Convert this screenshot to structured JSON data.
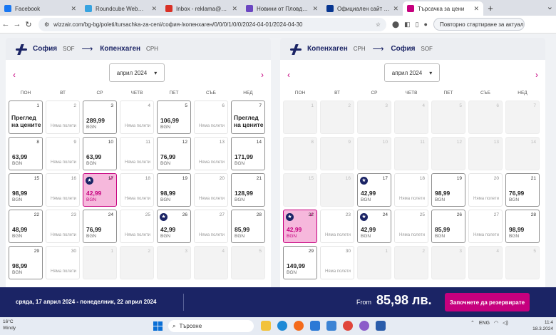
{
  "browser": {
    "tabs": [
      {
        "title": "Facebook",
        "color": "#1877f2",
        "active": false
      },
      {
        "title": "Roundcube Webmail :: Inb",
        "color": "#37a3e0",
        "active": false
      },
      {
        "title": "Inbox - reklama@poctepe",
        "color": "#d93025",
        "active": false
      },
      {
        "title": "Новини от Пловдив - Акт",
        "color": "#6b46c1",
        "active": false
      },
      {
        "title": "Официален сайт Ryanair",
        "color": "#073590",
        "active": false
      },
      {
        "title": "Търсачка за цени",
        "color": "#c6007e",
        "active": true
      }
    ],
    "new_tab": "+",
    "url": "wizzair.com/bg-bg/poleti/tursachka-za-ceni/софия-/копенхаген/0/0/0/1/0/0/2024-04-01/2024-04-30",
    "restart_label": "Повторно стартиране за актуализиране"
  },
  "left_panel": {
    "from_city": "София",
    "from_code": "SOF",
    "to_city": "Копенхаген",
    "to_code": "CPH",
    "month": "април 2024",
    "weekdays": [
      "ПОН",
      "ВТ",
      "СР",
      "ЧЕТВ",
      "ПЕТ",
      "СЪБ",
      "НЕД"
    ],
    "days": [
      {
        "d": "1",
        "type": "link",
        "text": "Преглед на цените"
      },
      {
        "d": "2",
        "type": "none",
        "text": "Няма полети"
      },
      {
        "d": "3",
        "type": "price",
        "price": "289,99",
        "cur": "BGN"
      },
      {
        "d": "4",
        "type": "none",
        "text": "Няма полети"
      },
      {
        "d": "5",
        "type": "price",
        "price": "106,99",
        "cur": "BGN"
      },
      {
        "d": "6",
        "type": "none",
        "text": "Няма полети"
      },
      {
        "d": "7",
        "type": "link",
        "text": "Преглед на цените"
      },
      {
        "d": "8",
        "type": "price",
        "price": "63,99",
        "cur": "BGN"
      },
      {
        "d": "9",
        "type": "none",
        "text": "Няма полети"
      },
      {
        "d": "10",
        "type": "price",
        "price": "63,99",
        "cur": "BGN"
      },
      {
        "d": "11",
        "type": "none",
        "text": "Няма полети"
      },
      {
        "d": "12",
        "type": "price",
        "price": "76,99",
        "cur": "BGN"
      },
      {
        "d": "13",
        "type": "none",
        "text": "Няма полети"
      },
      {
        "d": "14",
        "type": "price",
        "price": "171,99",
        "cur": "BGN"
      },
      {
        "d": "15",
        "type": "price",
        "price": "98,99",
        "cur": "BGN"
      },
      {
        "d": "16",
        "type": "none",
        "text": "Няма полети"
      },
      {
        "d": "17",
        "type": "price",
        "price": "42,99",
        "cur": "BGN",
        "star": true,
        "selected": true
      },
      {
        "d": "18",
        "type": "none",
        "text": "Няма полети"
      },
      {
        "d": "19",
        "type": "price",
        "price": "98,99",
        "cur": "BGN"
      },
      {
        "d": "20",
        "type": "none",
        "text": "Няма полети"
      },
      {
        "d": "21",
        "type": "price",
        "price": "128,99",
        "cur": "BGN"
      },
      {
        "d": "22",
        "type": "price",
        "price": "48,99",
        "cur": "BGN"
      },
      {
        "d": "23",
        "type": "none",
        "text": "Няма полети"
      },
      {
        "d": "24",
        "type": "price",
        "price": "76,99",
        "cur": "BGN"
      },
      {
        "d": "25",
        "type": "none",
        "text": "Няма полети"
      },
      {
        "d": "26",
        "type": "price",
        "price": "42,99",
        "cur": "BGN",
        "star": true
      },
      {
        "d": "27",
        "type": "none",
        "text": "Няма полети"
      },
      {
        "d": "28",
        "type": "price",
        "price": "85,99",
        "cur": "BGN"
      },
      {
        "d": "29",
        "type": "price",
        "price": "98,99",
        "cur": "BGN"
      },
      {
        "d": "30",
        "type": "none",
        "text": "Няма полети"
      },
      {
        "d": "1",
        "type": "na"
      },
      {
        "d": "2",
        "type": "na"
      },
      {
        "d": "3",
        "type": "na"
      },
      {
        "d": "4",
        "type": "na"
      },
      {
        "d": "5",
        "type": "na"
      }
    ]
  },
  "right_panel": {
    "from_city": "Копенхаген",
    "from_code": "CPH",
    "to_city": "София",
    "to_code": "SOF",
    "month": "април 2024",
    "weekdays": [
      "ПОН",
      "ВТ",
      "СР",
      "ЧЕТВ",
      "ПЕТ",
      "СЪБ",
      "НЕД"
    ],
    "days": [
      {
        "d": "1",
        "type": "na"
      },
      {
        "d": "2",
        "type": "na"
      },
      {
        "d": "3",
        "type": "na"
      },
      {
        "d": "4",
        "type": "na"
      },
      {
        "d": "5",
        "type": "na"
      },
      {
        "d": "6",
        "type": "na"
      },
      {
        "d": "7",
        "type": "na"
      },
      {
        "d": "8",
        "type": "na"
      },
      {
        "d": "9",
        "type": "na"
      },
      {
        "d": "10",
        "type": "na"
      },
      {
        "d": "11",
        "type": "na"
      },
      {
        "d": "12",
        "type": "na"
      },
      {
        "d": "13",
        "type": "na"
      },
      {
        "d": "14",
        "type": "na"
      },
      {
        "d": "15",
        "type": "na"
      },
      {
        "d": "16",
        "type": "na"
      },
      {
        "d": "17",
        "type": "price",
        "price": "42,99",
        "cur": "BGN",
        "star": true
      },
      {
        "d": "18",
        "type": "none",
        "text": "Няма полети"
      },
      {
        "d": "19",
        "type": "price",
        "price": "98,99",
        "cur": "BGN"
      },
      {
        "d": "20",
        "type": "none",
        "text": "Няма полети"
      },
      {
        "d": "21",
        "type": "price",
        "price": "76,99",
        "cur": "BGN"
      },
      {
        "d": "22",
        "type": "price",
        "price": "42,99",
        "cur": "BGN",
        "star": true,
        "selected": true
      },
      {
        "d": "23",
        "type": "none",
        "text": "Няма полети"
      },
      {
        "d": "24",
        "type": "price",
        "price": "42,99",
        "cur": "BGN",
        "star": true
      },
      {
        "d": "25",
        "type": "none",
        "text": "Няма полети"
      },
      {
        "d": "26",
        "type": "price",
        "price": "85,99",
        "cur": "BGN"
      },
      {
        "d": "27",
        "type": "none",
        "text": "Няма полети"
      },
      {
        "d": "28",
        "type": "price",
        "price": "98,99",
        "cur": "BGN"
      },
      {
        "d": "29",
        "type": "price",
        "price": "149,99",
        "cur": "BGN"
      },
      {
        "d": "30",
        "type": "none",
        "text": "Няма полети"
      },
      {
        "d": "1",
        "type": "na"
      },
      {
        "d": "2",
        "type": "na"
      },
      {
        "d": "3",
        "type": "na"
      },
      {
        "d": "4",
        "type": "na"
      },
      {
        "d": "5",
        "type": "na"
      }
    ]
  },
  "summary": {
    "dates": "сряда, 17 април 2024 - понеделник, 22 април 2024",
    "from_label": "From",
    "total": "85,98 лв.",
    "book_label": "Започнете да резервирате"
  },
  "taskbar": {
    "temp": "16°C",
    "weather": "Windy",
    "search_placeholder": "Търсене",
    "lang": "ENG",
    "time": "11:4",
    "date": "18.3.2024"
  },
  "colors": {
    "brand_navy": "#1b2465",
    "brand_pink": "#c6007e"
  }
}
